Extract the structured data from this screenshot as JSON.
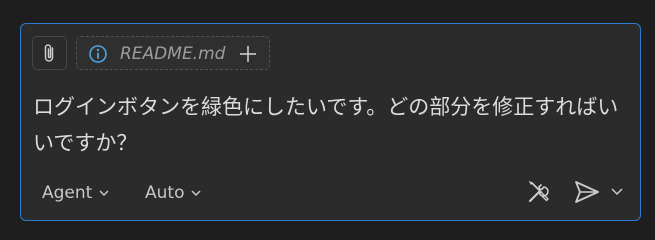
{
  "context": {
    "file_name": "README.md"
  },
  "prompt": {
    "text": "ログインボタンを緑色にしたいです。どの部分を修正すればいいですか？"
  },
  "toolbar": {
    "mode_label": "Agent",
    "model_label": "Auto"
  },
  "icons": {
    "attach": "paperclip-icon",
    "info": "info-icon",
    "add": "plus-icon",
    "tools": "wrench-screwdriver-icon",
    "send": "send-icon"
  },
  "colors": {
    "background": "#1e1e1e",
    "panel": "#2b2b2b",
    "focus_border": "#2e7ad1",
    "info_icon": "#4fa3e0",
    "text": "#dcdcdc"
  }
}
